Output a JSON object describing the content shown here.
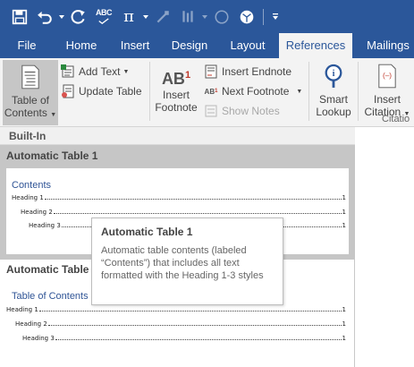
{
  "quick_access": {
    "icons": [
      "save-icon",
      "undo-icon",
      "redo-icon",
      "spelling-icon",
      "equation-icon",
      "format-painter-icon",
      "shape-icon",
      "customize-icon"
    ]
  },
  "tabs": [
    {
      "label": "File",
      "active": false
    },
    {
      "label": "Home",
      "active": false
    },
    {
      "label": "Insert",
      "active": false
    },
    {
      "label": "Design",
      "active": false
    },
    {
      "label": "Layout",
      "active": false
    },
    {
      "label": "References",
      "active": true
    },
    {
      "label": "Mailings",
      "active": false
    }
  ],
  "ribbon": {
    "toc_line1": "Table of",
    "toc_line2": "Contents",
    "add_text": "Add Text",
    "update_table": "Update Table",
    "footnote_icon_text": "AB",
    "footnote_superscript": "1",
    "insert_footnote_line1": "Insert",
    "insert_footnote_line2": "Footnote",
    "insert_endnote": "Insert Endnote",
    "next_footnote": "Next Footnote",
    "show_notes": "Show Notes",
    "smart_lookup_line1": "Smart",
    "smart_lookup_line2": "Lookup",
    "insert_citation_line1": "Insert",
    "insert_citation_line2": "Citation",
    "citations_group": "Citatio"
  },
  "gallery": {
    "section_label": "Built-In",
    "items": [
      {
        "title": "Automatic Table 1",
        "preview_heading": "Contents",
        "entries": [
          {
            "label": "Heading 1",
            "page": "1"
          },
          {
            "label": "Heading 2",
            "page": "1"
          },
          {
            "label": "Heading 3",
            "page": "1"
          }
        ]
      },
      {
        "title": "Automatic Table",
        "preview_heading": "Table of Contents",
        "entries": [
          {
            "label": "Heading 1",
            "page": "1"
          },
          {
            "label": "Heading 2",
            "page": "1"
          },
          {
            "label": "Heading 3",
            "page": "1"
          }
        ]
      }
    ]
  },
  "tooltip": {
    "title": "Automatic Table 1",
    "description": "Automatic table contents (labeled “Contents”) that includes all text formatted with the Heading 1-3 styles"
  },
  "colors": {
    "title_bar": "#2b579a",
    "ribbon_bg": "#f3f3f3",
    "selected_item": "#c6c6c6",
    "heading_blue": "#2f5496"
  }
}
